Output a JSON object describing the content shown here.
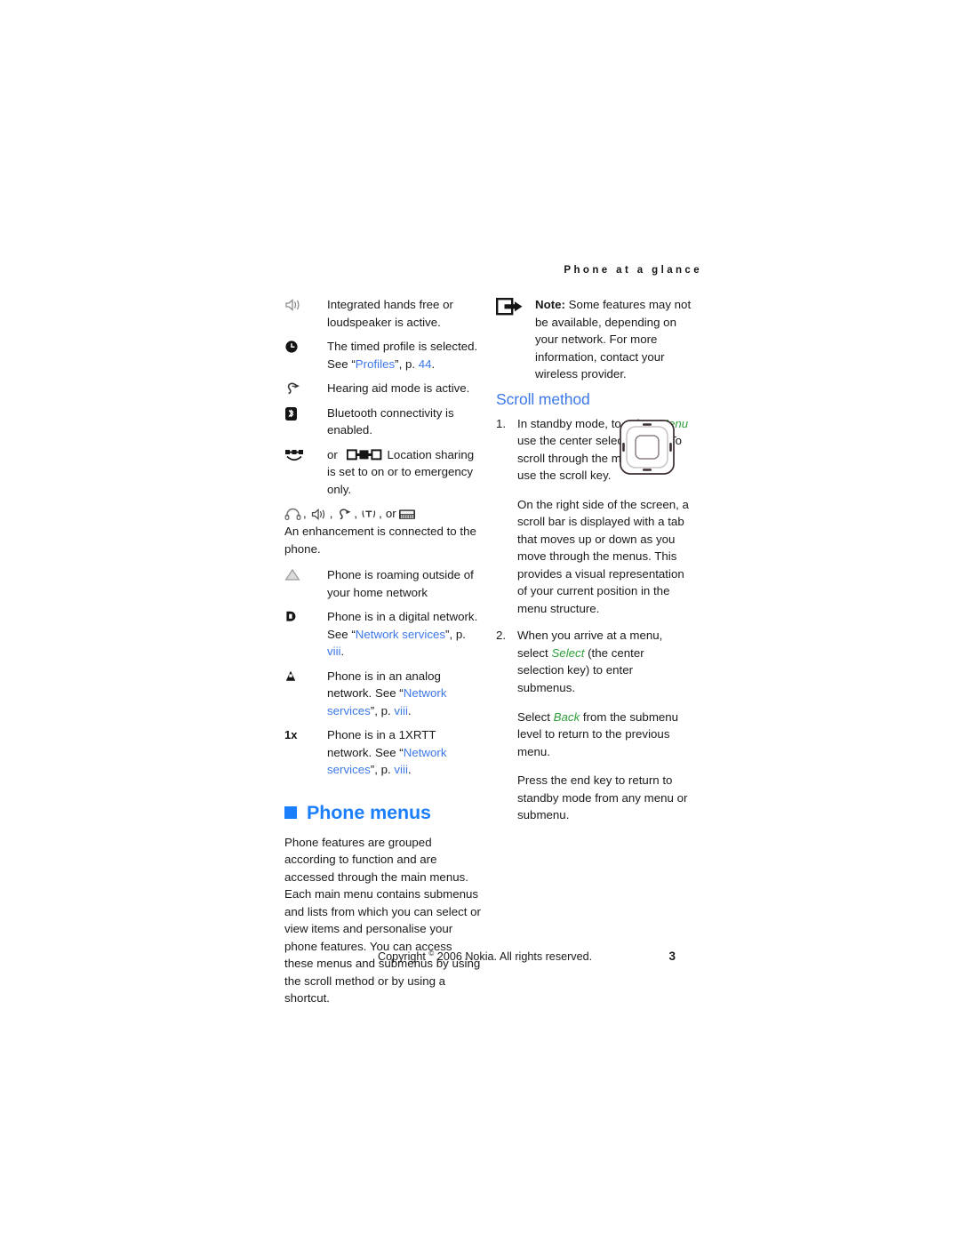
{
  "header": {
    "running_head": "Phone at a glance"
  },
  "left_column": {
    "status_items": [
      {
        "icon": "loudspeaker-icon",
        "text": "Integrated hands free or loudspeaker is active."
      },
      {
        "icon": "timed-profile-clock-icon",
        "text": "The timed profile is selected. See “Profiles”, p. 44.",
        "text_before_link": "The timed profile is selected. See “",
        "link": "Profiles",
        "text_mid": "”, p. ",
        "link2": "44",
        "text_after": "."
      },
      {
        "icon": "hearing-aid-icon",
        "text": "Hearing aid mode is active."
      },
      {
        "icon": "bluetooth-icon",
        "text": "Bluetooth connectivity is enabled."
      },
      {
        "icon": "location-sharing-icon",
        "text_before": "or",
        "icon2": "location-sharing-emergency-icon",
        "text_after": "Location sharing is set to on or to emergency only."
      }
    ],
    "enhancement": {
      "icons": [
        "headset-icon",
        "loudspeaker-icon",
        "hearing-aid-icon",
        "tty-icon",
        "car-kit-icon"
      ],
      "separator": ",",
      "or_label": "or",
      "text": "An enhancement is connected to the phone."
    },
    "network_items": [
      {
        "icon": "roaming-triangle-icon",
        "text": "Phone is roaming outside of your home network"
      },
      {
        "icon": "digital-network-d-icon",
        "text_before_link": "Phone is in a digital network. See “",
        "link": "Network services",
        "text_mid": "”, p. ",
        "link2": "viii",
        "text_after": "."
      },
      {
        "icon": "analog-network-a-icon",
        "text_before_link": "Phone is in an analog network. See “",
        "link": "Network services",
        "text_mid": "”, p. ",
        "link2": "viii",
        "text_after": "."
      },
      {
        "icon": "onexrtt-network-icon",
        "text_before_link": "Phone is in a 1XRTT network. See “",
        "link": "Network services",
        "text_mid": "”, p. ",
        "link2": "viii",
        "text_after": "."
      }
    ],
    "phone_menus": {
      "heading": "Phone menus",
      "paragraph": "Phone features are grouped according to function and are accessed through the main menus. Each main menu contains submenus and lists from which you can select or view items and personalise your phone features. You can access these menus and submenus by using the scroll method or by using a shortcut."
    }
  },
  "right_column": {
    "note": {
      "icon": "note-arrow-icon",
      "label": "Note:",
      "text": " Some features may not be available, depending on your network. For more information, contact your wireless provider."
    },
    "scroll_method": {
      "heading": "Scroll method",
      "step1_number": "1.",
      "step1_part1": "In standby mode, to select ",
      "step1_emph": "Menu",
      "step1_part2": " use the center selection key. To scroll through the main menu, use the scroll key.",
      "figure": "scroll-key-illustration",
      "para_scrollbar": "On the right side of the screen, a scroll bar is displayed with a tab that moves up or down as you move through the menus. This provides a visual representation of your current position in the menu structure.",
      "step2_number": "2.",
      "step2_part1": "When you arrive at a menu, select ",
      "step2_emph": "Select",
      "step2_part2": " (the center selection key) to enter submenus.",
      "para_back_part1": "Select ",
      "para_back_emph": "Back",
      "para_back_part2": " from the submenu level to return to the previous menu.",
      "para_endkey": "Press the end key to return to standby mode from any menu or submenu."
    }
  },
  "footer": {
    "copyright_before": "Copyright ",
    "copyright_symbol": "©",
    "copyright_after": " 2006 Nokia. All rights reserved.",
    "page_number": "3"
  },
  "colors": {
    "link_blue": "#3d78e8",
    "heading_blue": "#1b7ffb",
    "subheading_blue": "#3d78e8",
    "emphasis_green": "#2fa03a",
    "text": "#1a1a1a"
  }
}
